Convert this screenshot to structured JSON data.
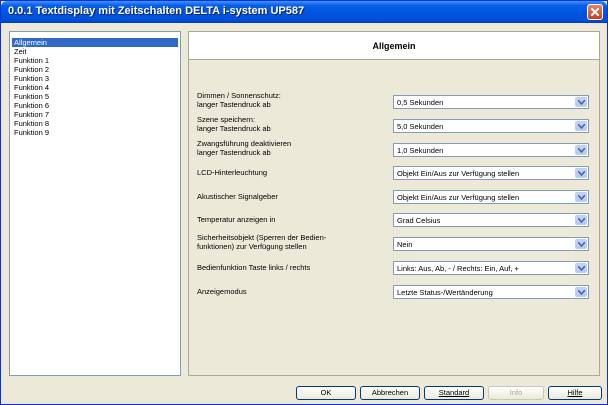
{
  "window": {
    "title": "0.0.1 Textdisplay mit Zeitschalten DELTA i-system UP587"
  },
  "sidebar": {
    "items": [
      {
        "label": "Allgemein",
        "selected": true
      },
      {
        "label": "Zeit"
      },
      {
        "label": "Funktion 1"
      },
      {
        "label": "Funktion 2"
      },
      {
        "label": "Funktion 3"
      },
      {
        "label": "Funktion 4"
      },
      {
        "label": "Funktion 5"
      },
      {
        "label": "Funktion 6"
      },
      {
        "label": "Funktion 7"
      },
      {
        "label": "Funktion 8"
      },
      {
        "label": "Funktion 9"
      }
    ]
  },
  "main": {
    "title": "Allgemein",
    "params": [
      {
        "label_lines": [
          "Dimmen / Sonnenschutz:",
          "langer Tastendruck ab"
        ],
        "value": "0,5 Sekunden"
      },
      {
        "label_lines": [
          "Szene speichern:",
          "langer Tastendruck ab"
        ],
        "value": "5,0 Sekunden"
      },
      {
        "label_lines": [
          "Zwangsführung deaktivieren",
          "langer Tastendruck ab"
        ],
        "value": "1,0  Sekunden"
      },
      {
        "label_lines": [
          "LCD-Hinterleuchtung"
        ],
        "value": "Objekt Ein/Aus zur Verfügung stellen"
      },
      {
        "label_lines": [
          "Akustischer Signalgeber"
        ],
        "value": "Objekt Ein/Aus zur Verfügung stellen"
      },
      {
        "label_lines": [
          "Temperatur anzeigen in"
        ],
        "value": "Grad Celsius"
      },
      {
        "label_lines": [
          "Sicherheitsobjekt (Sperren der Bedien-",
          "funktionen) zur Verfügung stellen"
        ],
        "value": "Nein"
      },
      {
        "label_lines": [
          "Bedienfunktion Taste links / rechts"
        ],
        "value": "Links: Aus, Ab, - / Rechts: Ein, Auf, +"
      },
      {
        "label_lines": [
          "Anzeigemodus"
        ],
        "value": "Letzte Status-/Wertänderung"
      }
    ]
  },
  "buttons": {
    "ok": "OK",
    "cancel": "Abbrechen",
    "standard": "Standard",
    "info": "Info",
    "help": "Hilfe"
  },
  "icons": {
    "close": "close-icon",
    "dropdown": "chevron-down-icon"
  },
  "colors": {
    "titlebar": "#0054e3",
    "selection": "#316ac5",
    "dialog_bg": "#ece9d8"
  }
}
